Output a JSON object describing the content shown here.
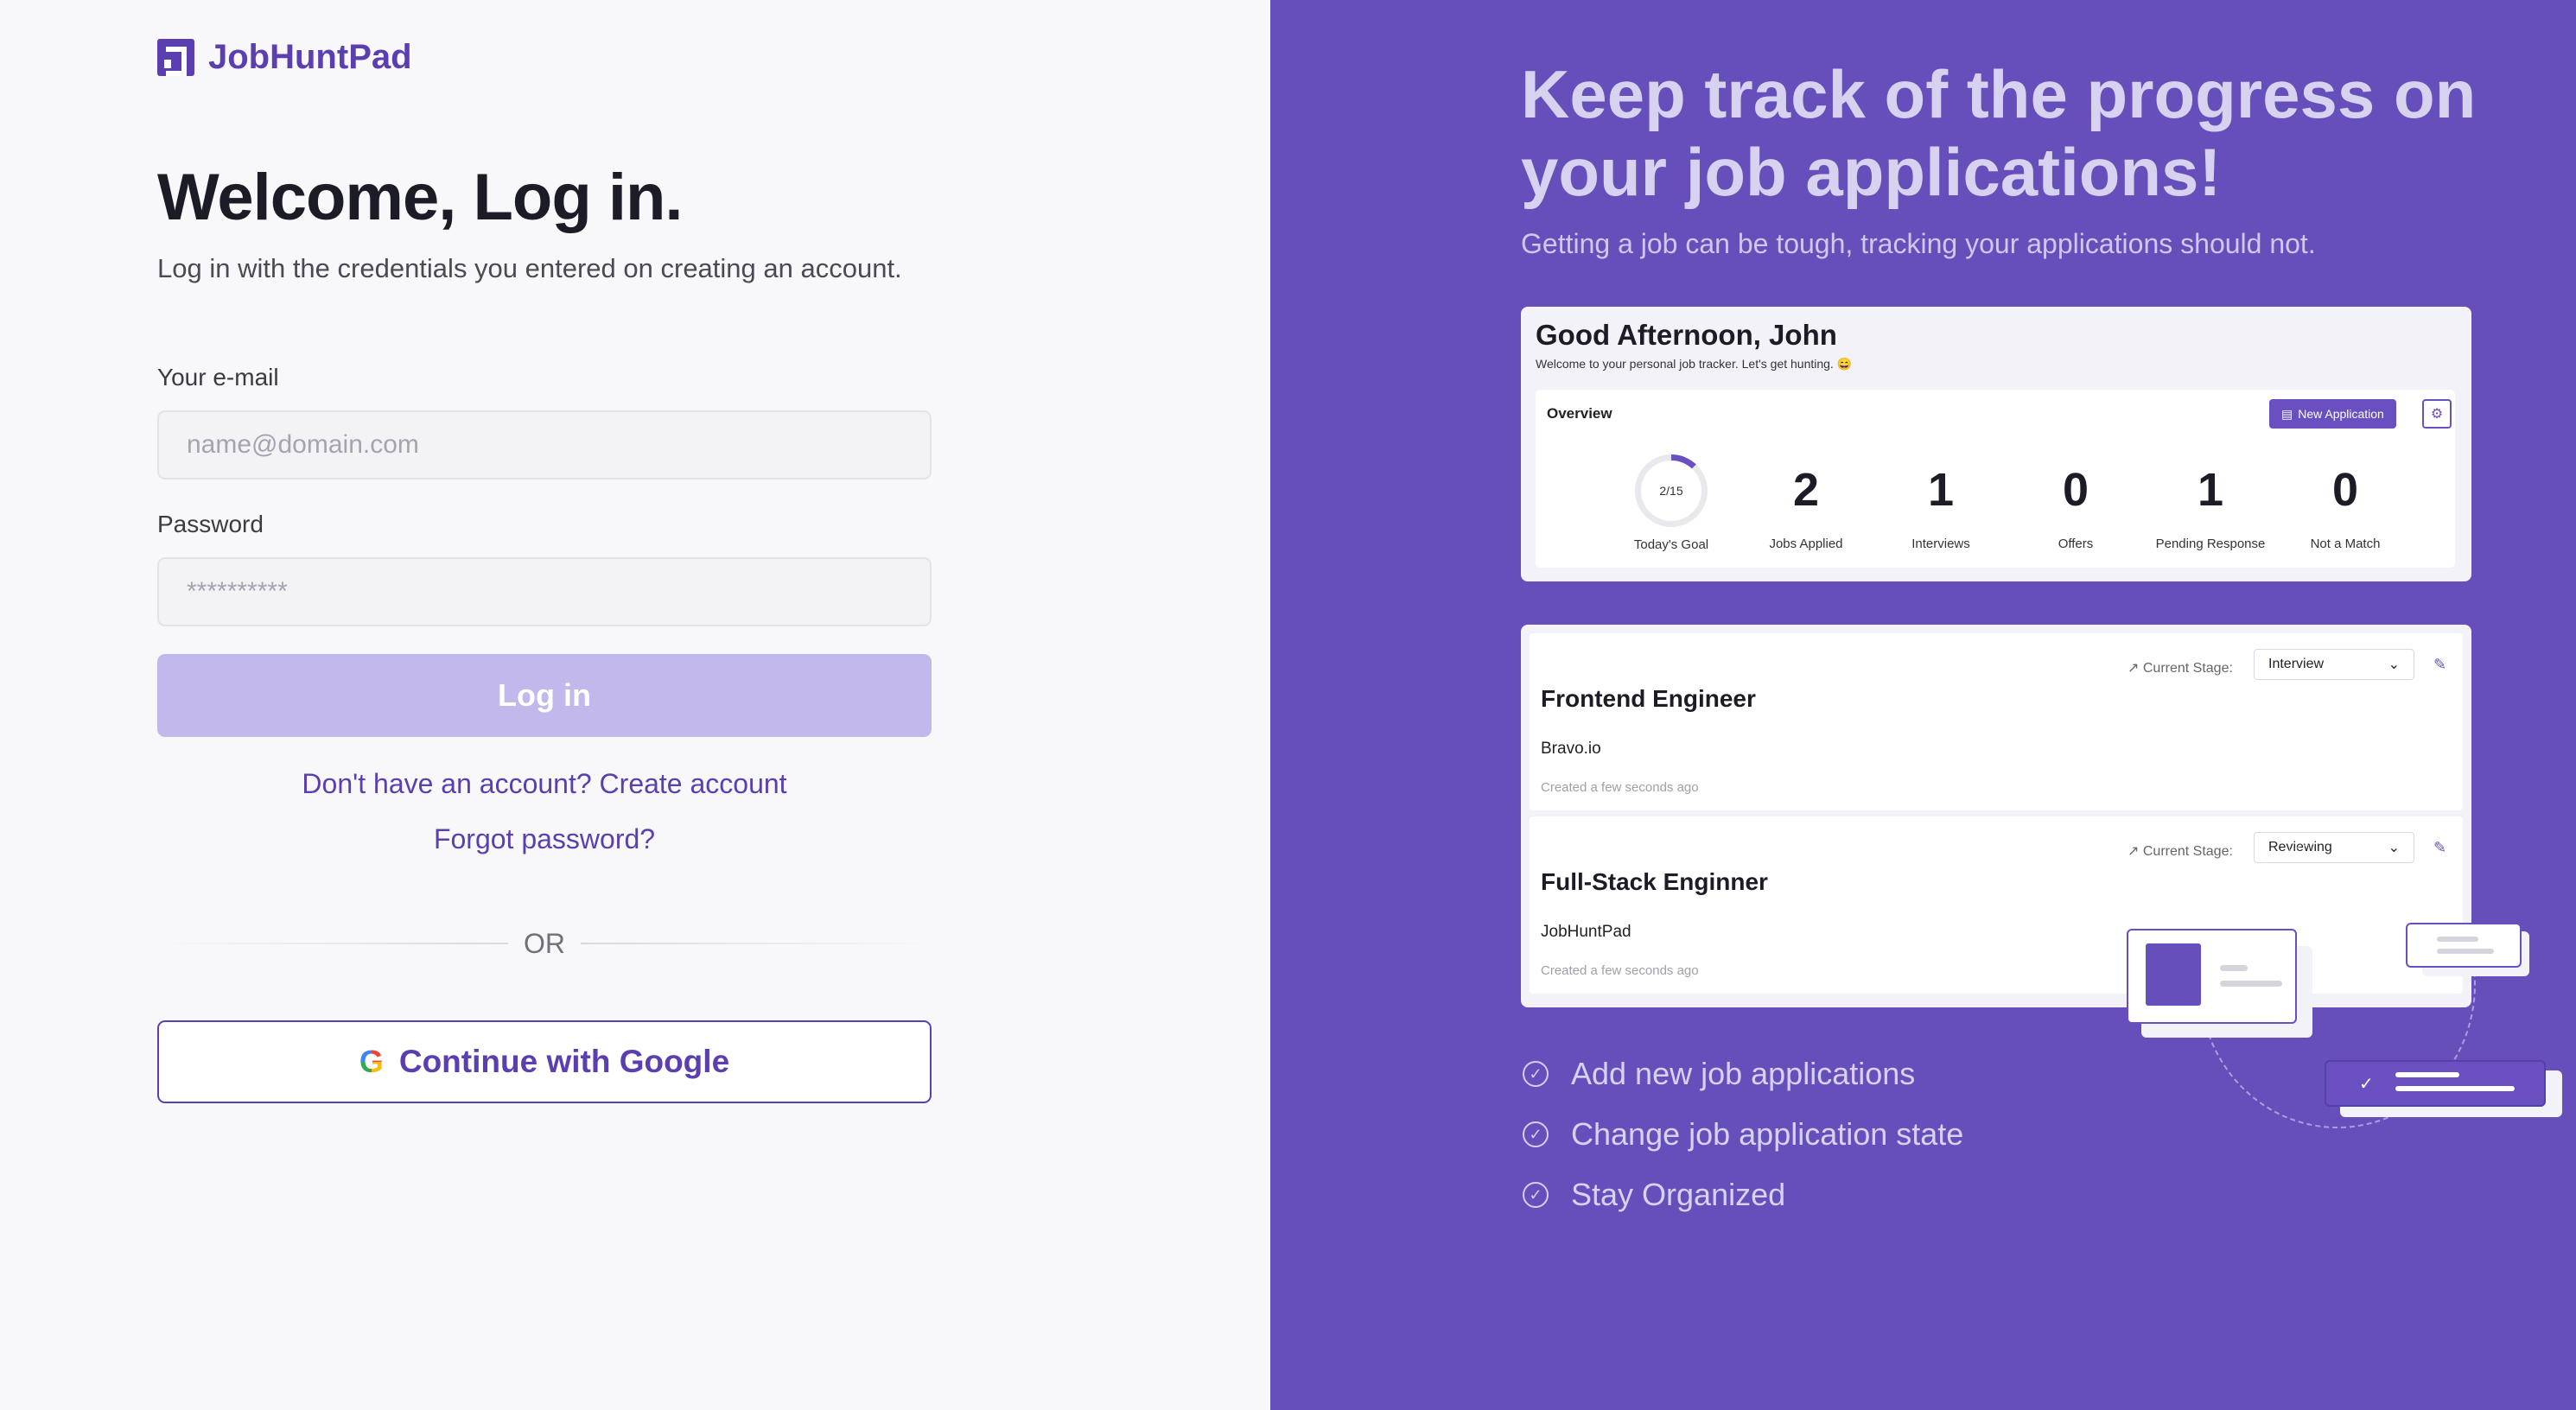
{
  "brand": {
    "name": "JobHuntPad",
    "icon": "logo-icon"
  },
  "login": {
    "title": "Welcome, Log in.",
    "subtitle": "Log in with the credentials you entered on creating an account.",
    "email_label": "Your e-mail",
    "email_placeholder": "name@domain.com",
    "email_value": "",
    "password_label": "Password",
    "password_placeholder": "**********",
    "password_value": "",
    "login_button": "Log in",
    "create_account_link": "Don't have an account? Create account",
    "forgot_password_link": "Forgot password?",
    "or_divider": "OR",
    "google_button": "Continue with Google",
    "google_icon": "G"
  },
  "promo": {
    "heading": "Keep track of the progress on your job applications!",
    "subheading": "Getting a job can be tough, tracking your applications should not.",
    "dashboard": {
      "greeting": "Good Afternoon, John",
      "greeting_sub": "Welcome to your personal job tracker. Let's get hunting. 😄",
      "overview_title": "Overview",
      "new_application_button": "New Application",
      "settings_icon": "⚙",
      "goal": {
        "value": "2/15",
        "label": "Today's Goal",
        "progress": 0.13
      },
      "stats": [
        {
          "value": "2",
          "label": "Jobs Applied"
        },
        {
          "value": "1",
          "label": "Interviews"
        },
        {
          "value": "0",
          "label": "Offers"
        },
        {
          "value": "1",
          "label": "Pending Response"
        },
        {
          "value": "0",
          "label": "Not a Match"
        }
      ]
    },
    "jobs": [
      {
        "title": "Frontend Engineer",
        "company": "Bravo.io",
        "created": "Created a few seconds ago",
        "stage_label": "Current Stage:",
        "stage": "Interview"
      },
      {
        "title": "Full-Stack Enginner",
        "company": "JobHuntPad",
        "created": "Created a few seconds ago",
        "stage_label": "Current Stage:",
        "stage": "Reviewing"
      }
    ],
    "features": [
      "Add new job applications",
      "Change job application state",
      "Stay Organized"
    ]
  },
  "colors": {
    "brand": "#5b3fb0",
    "panel": "#664fbb",
    "login_disabled": "#c3b8eb"
  }
}
